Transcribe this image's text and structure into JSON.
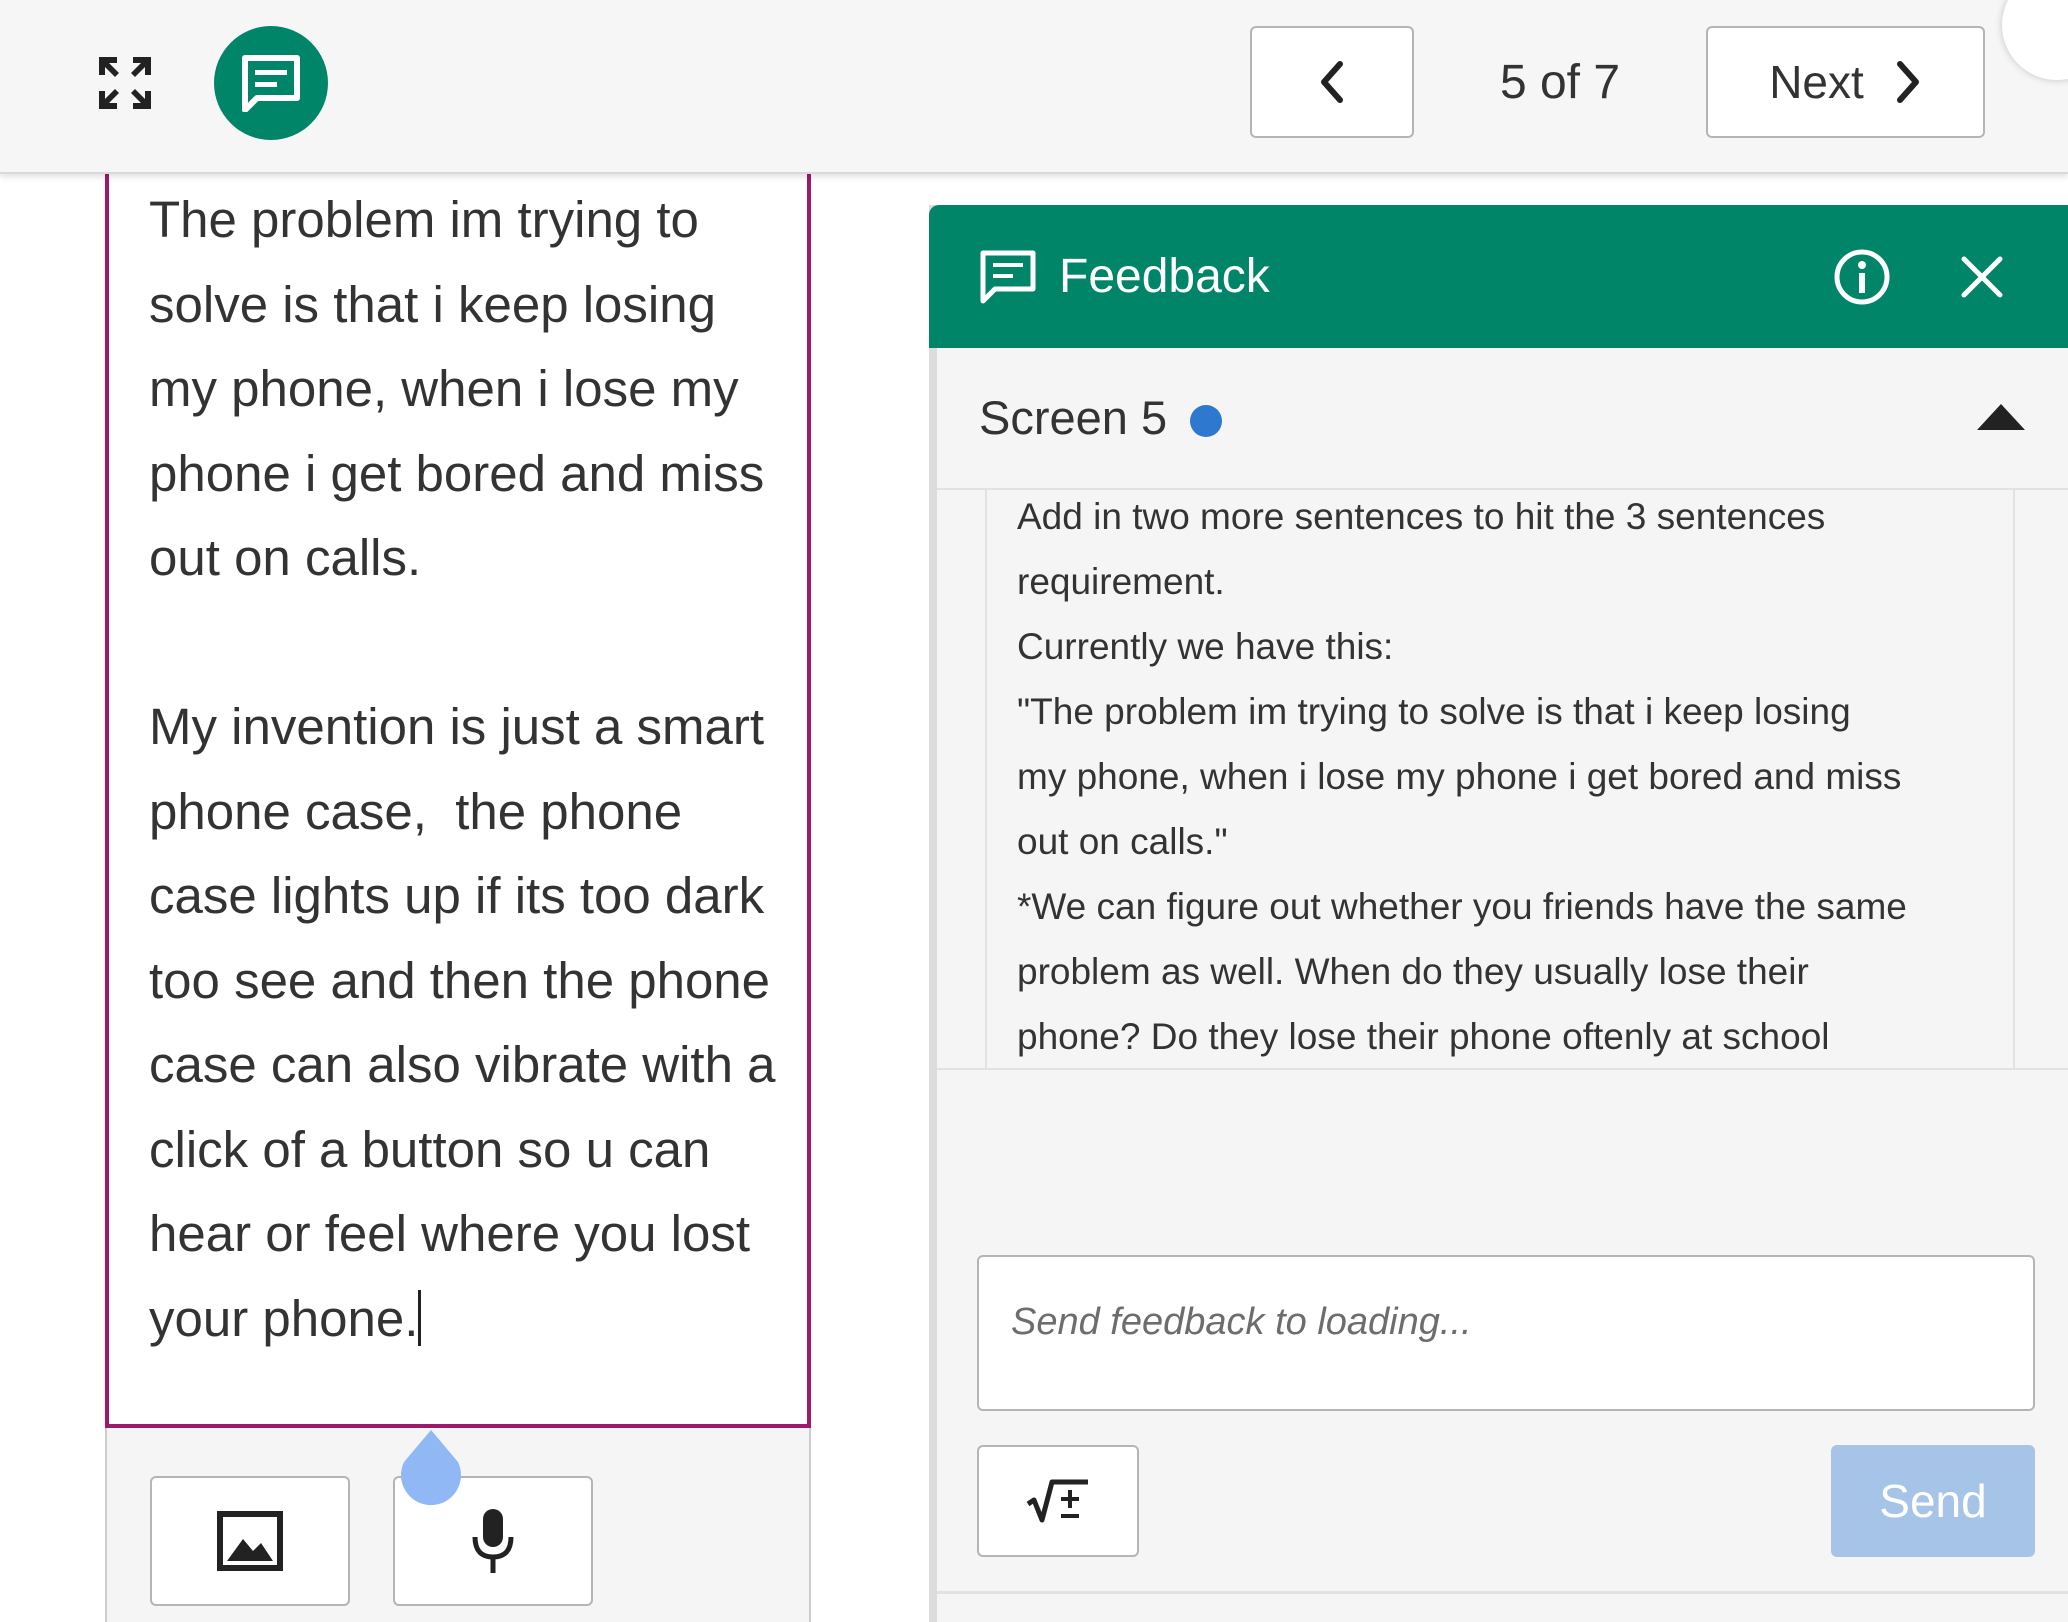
{
  "topbar": {
    "expand_icon": "expand-arrows-icon",
    "feedback_icon": "chat-feedback-icon",
    "prev_icon": "chevron-left-icon",
    "page_counter": "5 of 7",
    "next_label": "Next",
    "next_icon": "chevron-right-icon"
  },
  "editor": {
    "paragraph_1": "The problem im trying to solve is that i keep losing my phone, when i lose my phone i get bored and miss out on calls.",
    "paragraph_2": "My invention is just a smart phone case,  the phone case lights up if its too dark too see and then the phone case can also vibrate with a click of a button so u can hear or feel where you lost your phone.",
    "border_color": "#9c1a6b",
    "toolbar": {
      "image_icon": "image-icon",
      "mic_icon": "microphone-icon"
    }
  },
  "feedback_panel": {
    "title": "Feedback",
    "header_color": "#008569",
    "info_icon": "info-icon",
    "close_icon": "close-icon",
    "screen_label": "Screen 5",
    "status_dot_color": "#2f78cf",
    "collapse_icon": "caret-up-icon",
    "message_lines": [
      "Add in two more sentences to hit the 3 sentences",
      "requirement.",
      "Currently we have this:",
      "\"The problem im trying to solve is that i keep losing",
      "my phone, when i lose my phone i get bored and miss",
      "out on calls.\"",
      "*We can figure out whether you friends have the same",
      "problem as well. When do they usually lose their",
      "phone? Do they lose their phone oftenly at school"
    ],
    "input_placeholder": "Send feedback to loading...",
    "math_icon": "math-symbols-icon",
    "send_label": "Send",
    "send_color": "#a6c4e8"
  }
}
